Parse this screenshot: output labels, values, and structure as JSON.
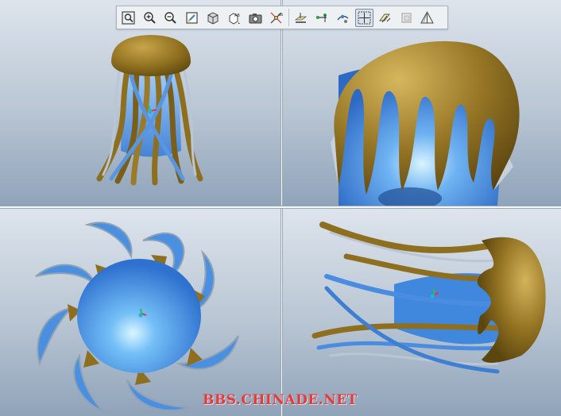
{
  "toolbar": {
    "buttons": [
      {
        "name": "zoom-fit",
        "icon": "zoom-fit-icon"
      },
      {
        "name": "zoom-in",
        "icon": "zoom-in-icon"
      },
      {
        "name": "zoom-out",
        "icon": "zoom-out-icon"
      },
      {
        "name": "repaint",
        "icon": "repaint-icon"
      },
      {
        "name": "shading-mode",
        "icon": "shaded-cube-icon"
      },
      {
        "name": "saved-views",
        "icon": "saved-views-icon"
      },
      {
        "name": "snapshot",
        "icon": "camera-icon"
      },
      {
        "name": "spin-center",
        "icon": "spin-center-icon"
      },
      {
        "name": "datum-planes",
        "icon": "datum-plane-icon"
      },
      {
        "name": "datum-axes",
        "icon": "datum-axis-icon"
      },
      {
        "name": "datum-points",
        "icon": "datum-point-icon"
      },
      {
        "name": "coordinate-systems",
        "icon": "coordinate-system-icon"
      },
      {
        "name": "annotations",
        "icon": "annotation-icon"
      },
      {
        "name": "layers",
        "icon": "layer-icon"
      },
      {
        "name": "perspective",
        "icon": "perspective-icon"
      }
    ],
    "active_index": 11
  },
  "viewports": {
    "top_left": "front-view",
    "top_right": "zoomed-view",
    "bottom_left": "top-view",
    "bottom_right": "side-view"
  },
  "colors": {
    "bell_gold": "#8e6f1f",
    "body_blue": "#3d88dd",
    "highlight": "#aee4ff",
    "edge_grey": "#9aa6b3",
    "watermark_red": "#e53a3a"
  },
  "watermark": {
    "text": "BBS.CHINADE.NET"
  }
}
